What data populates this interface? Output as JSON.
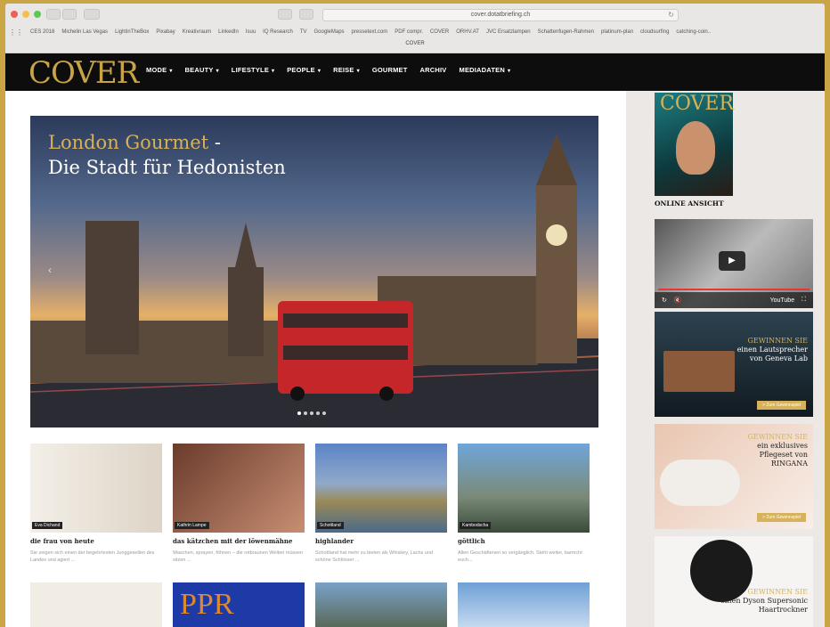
{
  "browser": {
    "url": "cover.dotatbriefing.ch",
    "bookmarks": [
      "CES 2018",
      "Michelin Las Vegas",
      "LightinTheBox",
      "Pixabay",
      "Kreativraum",
      "LinkedIn",
      "Isuu",
      "IQ Research",
      "TV",
      "GoogleMaps",
      "pressetext.com",
      "PDF compr.",
      "COVER",
      "ORHV.AT",
      "JVC Ersatzlampen",
      "Schattenfugen-Rahmen",
      "platinum-plan",
      "cloudsurfing",
      "catching-coin.."
    ],
    "tab_title": "COVER"
  },
  "site": {
    "logo": "COVER",
    "nav": [
      "MODE",
      "BEAUTY",
      "LIFESTYLE",
      "PEOPLE",
      "REISE",
      "GOURMET",
      "ARCHIV",
      "MEDIADATEN"
    ],
    "nav_caret": "▾"
  },
  "hero": {
    "title_gold": "London Gourmet",
    "title_sep": " -",
    "title_white": "Die Stadt für Hedonisten",
    "arrow": "‹"
  },
  "cards": [
    {
      "author": "Eva Dichand",
      "title": "die frau von heute",
      "desc": "Sie zeigen sich einen der begehrtesten Junggesellen des Landes und agiert ..."
    },
    {
      "author": "Kathrin Lampe",
      "title": "das kätzchen mit der löwenmähne",
      "desc": "Waschen, sprayen, föhnen – die rotbraunen Welten müssen sitzen ..."
    },
    {
      "author": "Schottland",
      "title": "highlander",
      "desc": "Schottland hat mehr zu bieten als Whiskey, Lachs und schöne Schlösser ..."
    },
    {
      "author": "Kambodscha",
      "title": "göttlich",
      "desc": "Allen Geschäftenen so vergänglich. Steht weiter, barmcht euch..."
    }
  ],
  "sidebar": {
    "mag_logo": "COVER",
    "online_label": "ONLINE ANSICHT",
    "video": {
      "play": "▶",
      "youtube": "YouTube"
    },
    "ad1": {
      "headline": "GEWINNEN SIE",
      "text1": "einen Lautsprecher",
      "text2": "von Geneva Lab",
      "button": "> Zum Gewinnspiel"
    },
    "ad2": {
      "headline": "GEWINNEN SIE",
      "text1": "ein exklusives",
      "text2": "Pflegeset von",
      "text3": "RINGANA",
      "button": "> Zum Gewinnspiel"
    },
    "ad3": {
      "headline": "GEWINNEN SIE",
      "text1": "einen Dyson Supersonic",
      "text2": "Haartrockner"
    }
  }
}
